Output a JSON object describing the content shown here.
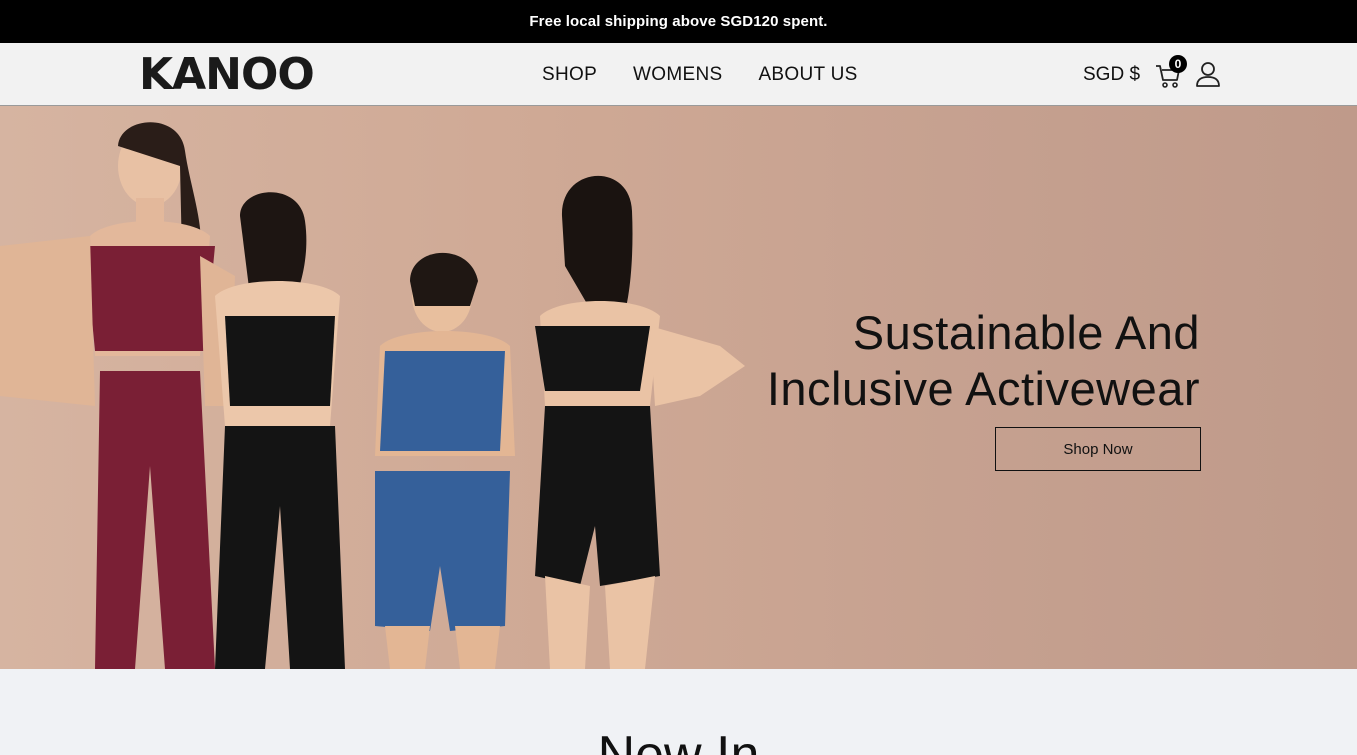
{
  "announcement": {
    "text": "Free local shipping above SGD120 spent."
  },
  "header": {
    "logo_text": "KANOO",
    "nav": [
      {
        "label": "SHOP"
      },
      {
        "label": "WOMENS"
      },
      {
        "label": "ABOUT US"
      }
    ],
    "currency": "SGD $",
    "cart_count": "0",
    "icons": [
      "cart-icon",
      "account-icon"
    ]
  },
  "hero": {
    "title_line1": "Sustainable And",
    "title_line2": "Inclusive Activewear",
    "cta_label": "Shop Now",
    "image_description_icon": "hero-photo"
  },
  "section": {
    "title": "New In"
  },
  "colors": {
    "announce_bg": "#000000",
    "header_bg": "#f2f2f2",
    "hero_bg": "#cfa995",
    "outfit_burgundy": "#7a1f35",
    "outfit_black": "#141414",
    "outfit_blue": "#35609a"
  }
}
